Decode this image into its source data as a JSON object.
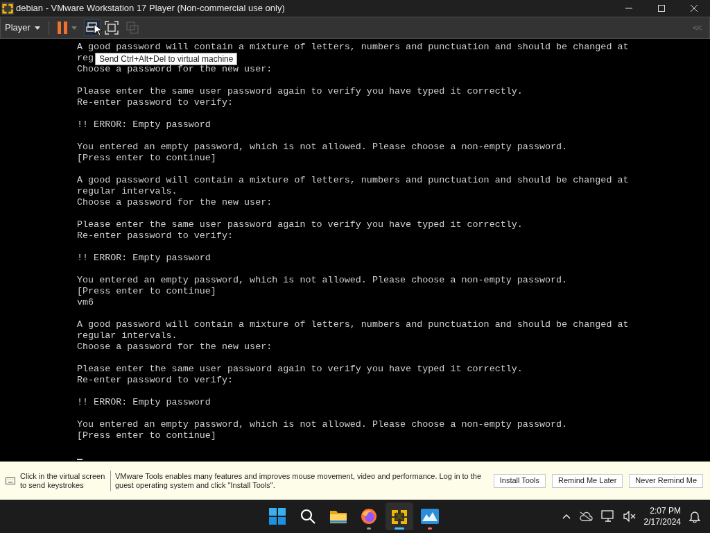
{
  "window": {
    "title": "debian - VMware Workstation 17 Player (Non-commercial use only)"
  },
  "toolbar": {
    "menu": "Player",
    "tooltip": "Send Ctrl+Alt+Del to virtual machine"
  },
  "terminal": {
    "blocks": [
      [
        "A good password will contain a mixture of letters, numbers and punctuation and should be changed at",
        "reg",
        "Choose a password for the new user:"
      ],
      [
        "Please enter the same user password again to verify you have typed it correctly.",
        "Re-enter password to verify:"
      ],
      [
        "!! ERROR: Empty password"
      ],
      [
        "You entered an empty password, which is not allowed. Please choose a non-empty password.",
        "[Press enter to continue]"
      ],
      [
        "A good password will contain a mixture of letters, numbers and punctuation and should be changed at",
        "regular intervals.",
        "Choose a password for the new user:"
      ],
      [
        "Please enter the same user password again to verify you have typed it correctly.",
        "Re-enter password to verify:"
      ],
      [
        "!! ERROR: Empty password"
      ],
      [
        "You entered an empty password, which is not allowed. Please choose a non-empty password.",
        "[Press enter to continue]",
        "vm6"
      ],
      [
        "A good password will contain a mixture of letters, numbers and punctuation and should be changed at",
        "regular intervals.",
        "Choose a password for the new user:"
      ],
      [
        "Please enter the same user password again to verify you have typed it correctly.",
        "Re-enter password to verify:"
      ],
      [
        "!! ERROR: Empty password"
      ],
      [
        "You entered an empty password, which is not allowed. Please choose a non-empty password.",
        "[Press enter to continue]"
      ]
    ],
    "cursor": true
  },
  "info_bar": {
    "hint": "Click in the virtual screen to send keystrokes",
    "message": "VMware Tools enables many features and improves mouse movement, video and performance. Log in to the guest operating system and click \"Install Tools\".",
    "buttons": [
      "Install Tools",
      "Remind Me Later",
      "Never Remind Me"
    ]
  },
  "taskbar": {
    "apps": [
      {
        "kind": "start",
        "selected": false
      },
      {
        "kind": "search",
        "selected": false
      },
      {
        "kind": "folder",
        "selected": false
      },
      {
        "kind": "browser",
        "selected": false,
        "color": "#9a9a9a"
      },
      {
        "kind": "vm",
        "selected": true,
        "color": "#4cc2ff"
      },
      {
        "kind": "viewer",
        "selected": false,
        "color": "#ff6b6b"
      }
    ],
    "clock": {
      "time": "2:07 PM",
      "date": "2/17/2024"
    }
  }
}
